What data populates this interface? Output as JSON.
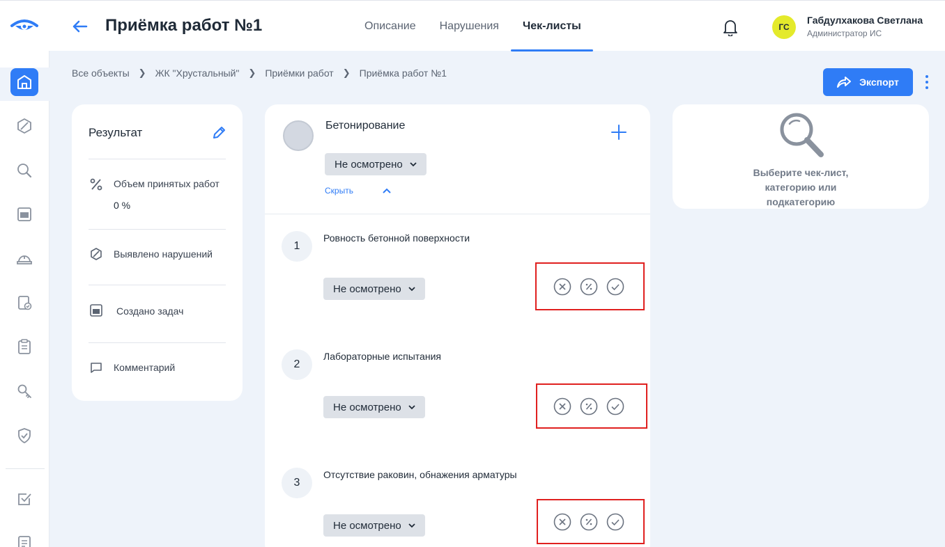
{
  "header": {
    "title": "Приёмка работ №1",
    "tabs": [
      {
        "label": "Описание",
        "active": false
      },
      {
        "label": "Нарушения",
        "active": false
      },
      {
        "label": "Чек-листы",
        "active": true
      }
    ],
    "user": {
      "initials": "ГС",
      "name": "Габдулхакова Светлана",
      "role": "Администратор ИС"
    }
  },
  "breadcrumb": [
    "Все объекты",
    "ЖК \"Хрустальный\"",
    "Приёмки работ",
    "Приёмка работ №1"
  ],
  "actions": {
    "export_label": "Экспорт"
  },
  "result": {
    "title": "Результат",
    "rows": [
      {
        "icon": "percent-icon",
        "label": "Объем принятых работ",
        "value": "0 %"
      },
      {
        "icon": "violation-icon",
        "label": "Выявлено нарушений"
      },
      {
        "icon": "tasks-icon",
        "label": "Создано задач"
      },
      {
        "icon": "comment-icon",
        "label": "Комментарий"
      }
    ]
  },
  "checklist": {
    "section_title": "Бетонирование",
    "section_status": "Не осмотрено",
    "hide_label": "Скрыть",
    "items": [
      {
        "number": "1",
        "title": "Ровность бетонной поверхности",
        "status": "Не осмотрено"
      },
      {
        "number": "2",
        "title": "Лабораторные испытания",
        "status": "Не осмотрено"
      },
      {
        "number": "3",
        "title": "Отсутствие раковин, обнажения арматуры",
        "status": "Не осмотрено"
      }
    ]
  },
  "empty_state": {
    "lines": [
      "Выберите чек-лист,",
      "категорию или",
      "подкатегорию"
    ]
  },
  "colors": {
    "accent": "#2f7cf6",
    "highlight": "#e0201f",
    "avatar": "#e4ea2b",
    "background": "#eef3fa"
  }
}
